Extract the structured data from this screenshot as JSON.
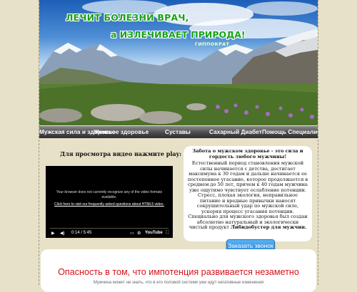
{
  "header": {
    "slogan_line1": "ЛЕЧИТ БОЛЕЗНИ ВРАЧ,",
    "slogan_line2": "а ИЗЛЕЧИВАЕТ ПРИРОДА!",
    "author": "ГИППОКРАТ"
  },
  "nav": {
    "items": [
      {
        "label": "Мужская сила и здоровье"
      },
      {
        "label": "Женское здоровье"
      },
      {
        "label": "Суставы"
      },
      {
        "label": "Сахарный Диабет"
      },
      {
        "label": "Помощь Специалист"
      }
    ]
  },
  "video": {
    "heading": "Для просмотра видео нажмите play:",
    "message": "Your browser does not currently recognize any of the video formats available.",
    "faq_link": "Click here to visit our frequently asked questions about HTML5 video.",
    "time": "0:14 / 5:45",
    "brand": "YouTube"
  },
  "card": {
    "heading": "Забота о мужском здоровье - это сила и гордость любого мужчины!",
    "body": "Естественный период становления мужской силы начинается с детства, достигает максимума к 30 годам и дальше начинается ее постепенное угасание, которое продолжается в среднем до 50 лет, причем к 40 годам мужчина уже ощутимо чувствует ослабление потенции. Стресс, плохая экология, неправильное питание и вредные привычки наносят сокрушительный удар по мужской силе, ускоряя процесс угасания потенции. Специально для мужского здоровья был создан абсолютно натуральный и экологически чистый продукт",
    "product": "Либидобустер для мужчин."
  },
  "cta": {
    "label": "Заказать звонок"
  },
  "bottom": {
    "headline": "Опасность в том, что импотенция развивается незаметно",
    "sub": "Мужчина может не знать, что в его половой системе уже идут негативные изменения"
  },
  "colors": {
    "page_background": "#e6e1c7",
    "slogan_green": "#1aa31a",
    "danger_red": "#d4121b",
    "cta_blue": "#2e86d9"
  }
}
